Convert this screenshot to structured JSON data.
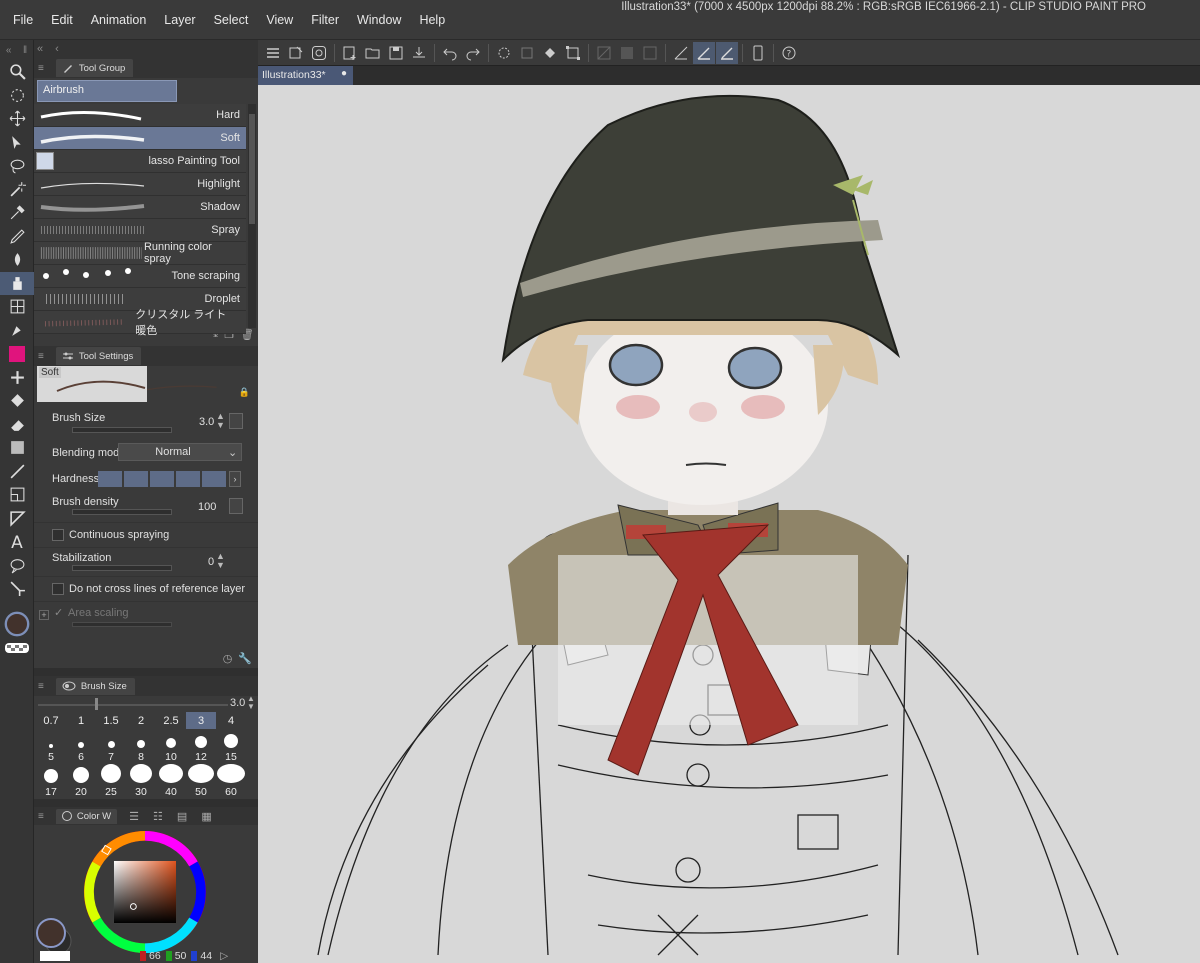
{
  "menu": [
    "File",
    "Edit",
    "Animation",
    "Layer",
    "Select",
    "View",
    "Filter",
    "Window",
    "Help"
  ],
  "window_title": "Illustration33* (7000 x 4500px 1200dpi 88.2% : RGB:sRGB IEC61966-2.1)  - CLIP STUDIO PAINT PRO",
  "tool_group": {
    "tab_label": "Tool Group",
    "active_tool": "Airbrush"
  },
  "brushes": [
    {
      "label": "Hard",
      "selected": false
    },
    {
      "label": "Soft",
      "selected": true
    },
    {
      "label": "lasso Painting Tool",
      "selected": false
    },
    {
      "label": "Highlight",
      "selected": false
    },
    {
      "label": "Shadow",
      "selected": false
    },
    {
      "label": "Spray",
      "selected": false
    },
    {
      "label": "Running color spray",
      "selected": false
    },
    {
      "label": "Tone scraping",
      "selected": false
    },
    {
      "label": "Droplet",
      "selected": false
    },
    {
      "label": "クリスタル ライト 暖色",
      "selected": false
    }
  ],
  "tool_settings": {
    "tab_label": "Tool Settings",
    "preset_name": "Soft",
    "brush_size_label": "Brush Size",
    "brush_size_value": "3.0",
    "blending_mode_label": "Blending mode",
    "blending_mode_value": "Normal",
    "hardness_label": "Hardness",
    "brush_density_label": "Brush density",
    "brush_density_value": "100",
    "continuous_spraying_label": "Continuous spraying",
    "stabilization_label": "Stabilization",
    "stabilization_value": "0",
    "ref_layer_label": "Do not cross lines of reference layer",
    "area_scaling_label": "Area scaling"
  },
  "brush_size_panel": {
    "tab_label": "Brush Size",
    "value": "3.0",
    "row1": [
      "0.7",
      "1",
      "1.5",
      "2",
      "2.5",
      "3",
      "4"
    ],
    "row2": [
      "5",
      "6",
      "7",
      "8",
      "10",
      "12",
      "15"
    ],
    "row3": [
      "17",
      "20",
      "25",
      "30",
      "40",
      "50",
      "60"
    ],
    "selected": "3"
  },
  "color_panel": {
    "tab_label": "Color W",
    "r": "66",
    "g": "50",
    "b": "44",
    "main_color": "#42322c",
    "sub_color": "#2b2b2b"
  },
  "document": {
    "tab_label": "Illustration33*"
  },
  "colors": {
    "accent": "#6a7896",
    "highlight_tool": "#e0147d"
  }
}
